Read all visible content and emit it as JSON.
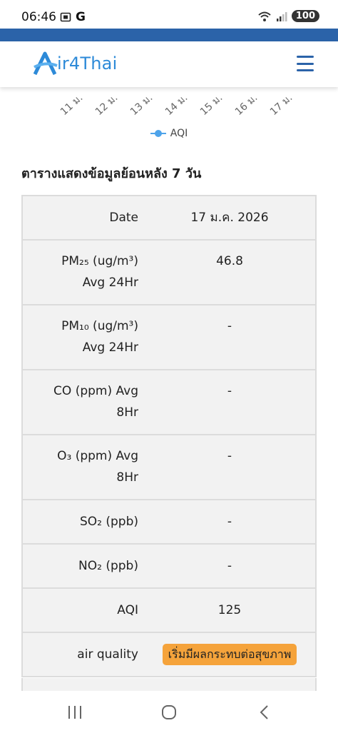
{
  "status_bar": {
    "time": "06:46",
    "left_icons": [
      "screenshot-icon",
      "google-icon"
    ],
    "google_letter": "G",
    "battery": "100"
  },
  "header": {
    "logo_text": "ir4Thai",
    "logo_letter": "A",
    "brand_color": "#2d8ad8",
    "menu_icon": "hamburger-menu-icon"
  },
  "chart": {
    "x_ticks": [
      "11 ม.",
      "12 ม.",
      "13 ม.",
      "14 ม.",
      "15 ม.",
      "16 ม.",
      "17 ม."
    ],
    "legend": "AQI",
    "legend_color": "#4da3ea"
  },
  "section_title": "ตารางแสดงข้อมูลย้อนหลัง 7 วัน",
  "table": {
    "date_label": "Date",
    "date_value": "17 ม.ค. 2026",
    "pm25_label_line1": "PM₂₅ (ug/m³)",
    "pm25_label_line2": "Avg 24Hr",
    "pm25_value": "46.8",
    "pm10_label_line1": "PM₁₀ (ug/m³)",
    "pm10_label_line2": "Avg 24Hr",
    "pm10_value": "-",
    "co_label_line1": "CO (ppm) Avg",
    "co_label_line2": "8Hr",
    "co_value": "-",
    "o3_label_line1": "O₃ (ppm) Avg",
    "o3_label_line2": "8Hr",
    "o3_value": "-",
    "so2_label": "SO₂ (ppb)",
    "so2_value": "-",
    "no2_label": "NO₂ (ppb)",
    "no2_value": "-",
    "aqi_label": "AQI",
    "aqi_value": "125",
    "air_quality_label": "air quality",
    "air_quality_value": "เริ่มมีผลกระทบต่อสุขภาพ",
    "air_quality_color": "#f5a33b"
  },
  "nav_bar": {
    "icons": [
      "recent-apps-icon",
      "home-icon",
      "back-icon"
    ]
  }
}
